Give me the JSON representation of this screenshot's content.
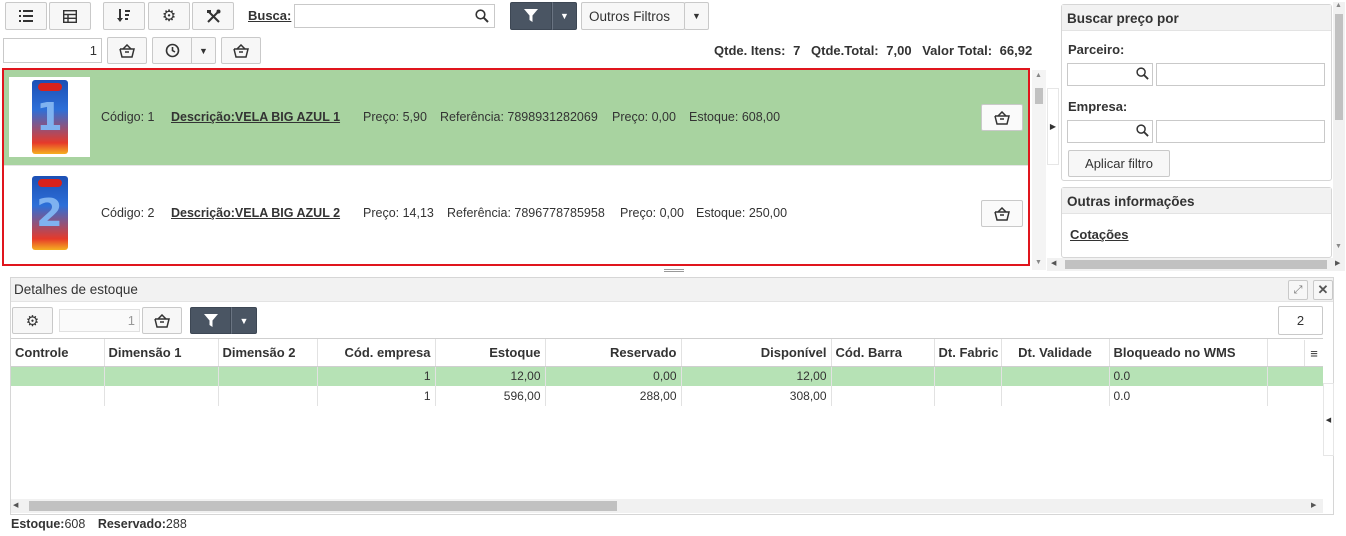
{
  "toolbar": {
    "search_label": "Busca:",
    "search_value": "",
    "outros_filtros_label": "Outros Filtros"
  },
  "qty_row": {
    "qty_value": "1",
    "summary_itens_label": "Qtde. Itens:",
    "summary_itens_value": "7",
    "summary_total_label": "Qtde.Total:",
    "summary_total_value": "7,00",
    "summary_valor_label": "Valor Total:",
    "summary_valor_value": "66,92"
  },
  "products": [
    {
      "codigo": "Código: 1",
      "descricao": "Descrição:VELA BIG AZUL 1",
      "preco": "Preço: 5,90",
      "referencia": "Referência: 7898931282069",
      "preco2": "Preço: 0,00",
      "estoque": "Estoque: 608,00",
      "digit": "1",
      "selected": true
    },
    {
      "codigo": "Código: 2",
      "descricao": "Descrição:VELA BIG AZUL 2",
      "preco": "Preço: 14,13",
      "referencia": "Referência: 7896778785958",
      "preco2": "Preço: 0,00",
      "estoque": "Estoque: 250,00",
      "digit": "2",
      "selected": false
    }
  ],
  "side_panel": {
    "price_title": "Buscar preço por",
    "parceiro_label": "Parceiro:",
    "empresa_label": "Empresa:",
    "apply_label": "Aplicar filtro",
    "outras_title": "Outras informações",
    "cotacoes_label": "Cotações"
  },
  "details": {
    "title": "Detalhes de estoque",
    "qty_value": "1",
    "page_value": "2",
    "columns": [
      "Controle",
      "Dimensão 1",
      "Dimensão 2",
      "Cód. empresa",
      "Estoque",
      "Reservado",
      "Disponível",
      "Cód. Barra",
      "Dt. Fabric",
      "Dt. Validade",
      "Bloqueado no WMS"
    ],
    "rows": [
      [
        "",
        "",
        "",
        "1",
        "12,00",
        "0,00",
        "12,00",
        "",
        "",
        "",
        "0.0"
      ],
      [
        "",
        "",
        "",
        "1",
        "596,00",
        "288,00",
        "308,00",
        "",
        "",
        "",
        "0.0"
      ]
    ],
    "footer_estoque_label": "Estoque:",
    "footer_estoque_value": "608",
    "footer_reservado_label": "Reservado:",
    "footer_reservado_value": "288"
  },
  "colors": {
    "selected_row": "#a8d3a0",
    "selected_grid_row": "#b6e2b5",
    "highlight_border": "#e0151d",
    "dark_button": "#4a5563"
  }
}
